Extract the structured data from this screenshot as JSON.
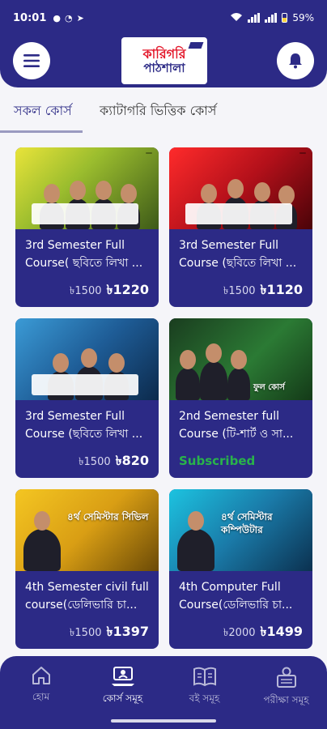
{
  "status_bar": {
    "time": "10:01",
    "battery": "59%"
  },
  "header": {
    "logo_line1": "কারিগরি",
    "logo_line2": "পাঠশালা"
  },
  "tabs": [
    {
      "label": "সকল কোর্স",
      "active": true
    },
    {
      "label": "ক্যাটাগরি ভিত্তিক কোর্স",
      "active": false
    }
  ],
  "courses": [
    {
      "title": "3rd Semester Full Course( ছবিতে লিখা ...",
      "old_price": "৳1500",
      "new_price": "৳1220",
      "thumb_text": ""
    },
    {
      "title": "3rd Semester Full Course (ছবিতে লিখা ...",
      "old_price": "৳1500",
      "new_price": "৳1120",
      "thumb_text": ""
    },
    {
      "title": "3rd Semester Full Course (ছবিতে লিখা ...",
      "old_price": "৳1500",
      "new_price": "৳820",
      "thumb_text": ""
    },
    {
      "title": "2nd Semester full Course (টি-শার্ট ও সা...",
      "status": "Subscribed",
      "thumb_text": "ফুল কোর্স"
    },
    {
      "title": "4th Semester civil full course(ডেলিভারি চা...",
      "old_price": "৳1500",
      "new_price": "৳1397",
      "thumb_text": "৪র্থ সেমিস্টার সিভিল"
    },
    {
      "title": "4th Computer Full Course(ডেলিভারি চা...",
      "old_price": "৳2000",
      "new_price": "৳1499",
      "thumb_text": "৪র্থ সেমিস্টার কম্পিউটার"
    }
  ],
  "bottom_nav": [
    {
      "label": "হোম",
      "icon": "home-icon",
      "active": false
    },
    {
      "label": "কোর্স সমূহ",
      "icon": "course-icon",
      "active": true
    },
    {
      "label": "বই সমূহ",
      "icon": "book-icon",
      "active": false
    },
    {
      "label": "পরীক্ষা সমূহ",
      "icon": "exam-icon",
      "active": false
    }
  ],
  "colors": {
    "primary": "#2c2a86",
    "subscribed": "#29b34a"
  }
}
